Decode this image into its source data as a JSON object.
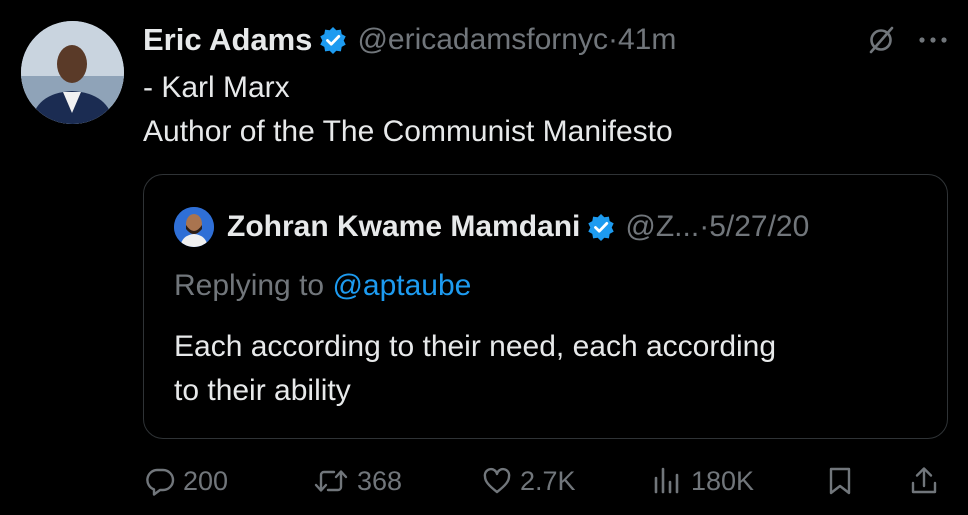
{
  "author": {
    "name": "Eric Adams",
    "handle": "@ericadamsfornyc",
    "separator": "·",
    "time": "41m"
  },
  "tweet": {
    "lines": [
      "- Karl Marx",
      "Author of the The Communist Manifesto"
    ]
  },
  "quote": {
    "name": "Zohran Kwame Mamdani",
    "handle": "@Z...",
    "separator": "·",
    "date": "5/27/20",
    "replying_prefix": "Replying to",
    "replying_to": "@aptaube",
    "lines": [
      "Each according to their need, each according",
      "to their ability"
    ]
  },
  "actions": {
    "replies": "200",
    "reposts": "368",
    "likes": "2.7K",
    "views": "180K"
  },
  "icons": [
    "verified-badge-icon",
    "grok-icon",
    "more-icon",
    "reply-icon",
    "repost-icon",
    "like-icon",
    "views-icon",
    "bookmark-icon",
    "share-icon"
  ],
  "colors": {
    "background": "#000000",
    "text": "#e7e9ea",
    "secondary": "#71767b",
    "accent": "#1d9bf0",
    "border": "#2f3336"
  }
}
